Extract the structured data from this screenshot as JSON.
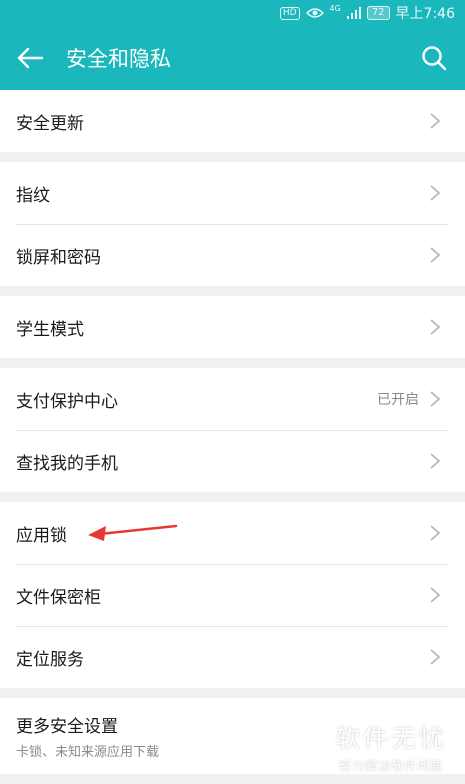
{
  "status_bar": {
    "hd": "HD",
    "signal_type": "4G",
    "battery": "72",
    "time": "早上7:46"
  },
  "header": {
    "title": "安全和隐私",
    "back_icon": "arrow-left-icon",
    "search_icon": "search-icon"
  },
  "items": {
    "security_update": "安全更新",
    "fingerprint": "指纹",
    "lock_screen": "锁屏和密码",
    "student_mode": "学生模式",
    "payment_protection": "支付保护中心",
    "payment_protection_status": "已开启",
    "find_phone": "查找我的手机",
    "app_lock": "应用锁",
    "file_safe": "文件保密柜",
    "location": "定位服务",
    "more_security": "更多安全设置",
    "more_security_sub": "卡锁、未知来源应用下载"
  },
  "watermark": {
    "main": "软件无忧",
    "sub": "努力解决软件问题"
  },
  "colors": {
    "accent": "#1ab7bd",
    "annotation_arrow": "#e53935"
  }
}
